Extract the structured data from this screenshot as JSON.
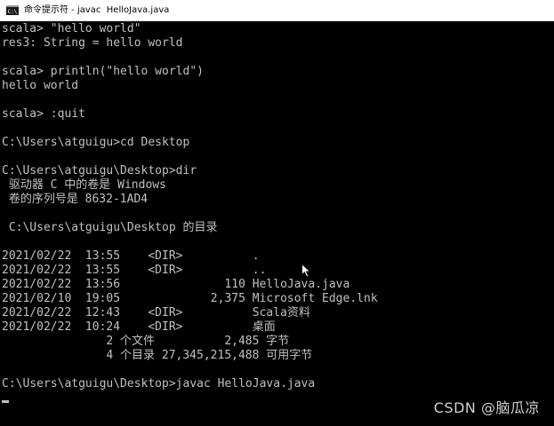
{
  "window": {
    "title": "命令提示符 - javac  HelloJava.java",
    "icon": "cmd-icon"
  },
  "console": {
    "lines": [
      "scala> \"hello world\"",
      "res3: String = hello world",
      "",
      "scala> println(\"hello world\")",
      "hello world",
      "",
      "scala> :quit",
      "",
      "C:\\Users\\atguigu>cd Desktop",
      "",
      "C:\\Users\\atguigu\\Desktop>dir",
      " 驱动器 C 中的卷是 Windows",
      " 卷的序列号是 8632-1AD4",
      "",
      " C:\\Users\\atguigu\\Desktop 的目录",
      "",
      "2021/02/22  13:55    <DIR>          .",
      "2021/02/22  13:55    <DIR>          ..",
      "2021/02/22  13:56               110 HelloJava.java",
      "2021/02/10  19:05             2,375 Microsoft Edge.lnk",
      "2021/02/22  12:43    <DIR>          Scala资料",
      "2021/02/22  10:24    <DIR>          桌面",
      "               2 个文件          2,485 字节",
      "               4 个目录 27,345,215,488 可用字节",
      "",
      "C:\\Users\\atguigu\\Desktop>javac HelloJava.java"
    ]
  },
  "watermark": "CSDN @脑瓜凉",
  "colors": {
    "background": "#000000",
    "text": "#c0c0c0",
    "titlebar": "#ffffff"
  }
}
